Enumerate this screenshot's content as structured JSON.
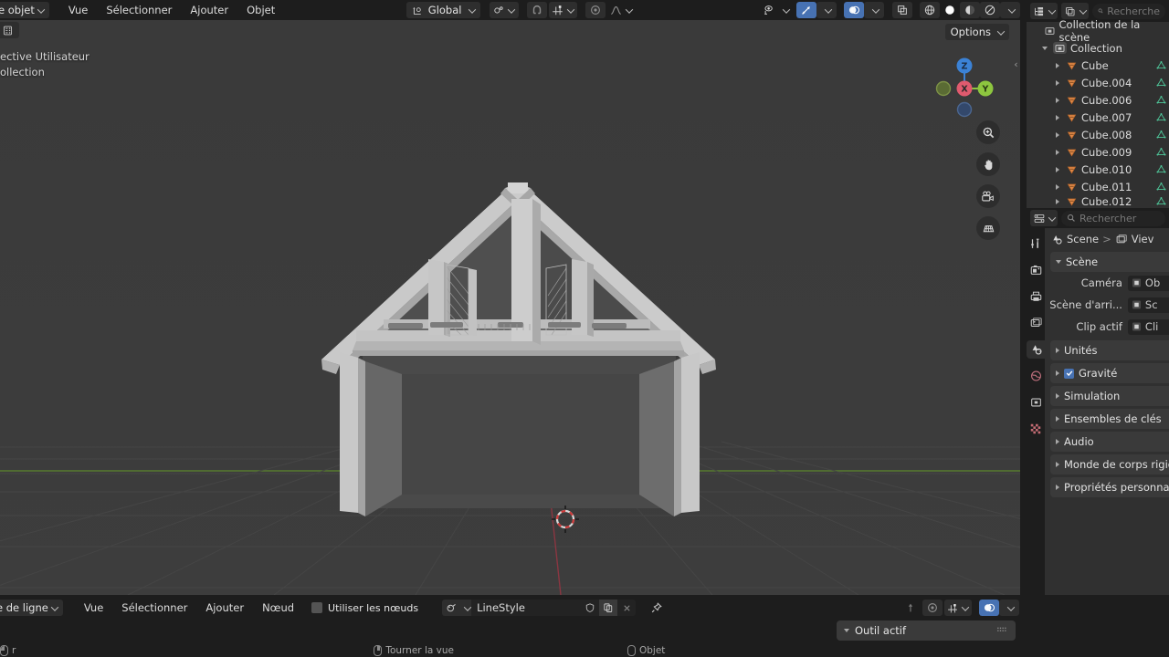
{
  "app": {
    "name": "Blender",
    "language": "fr"
  },
  "viewport_header": {
    "mode": "e objet",
    "menus": [
      "Vue",
      "Sélectionner",
      "Ajouter",
      "Objet"
    ],
    "transform_orientation": "Global",
    "icons": {
      "transform_orientation": "orientation-icon",
      "snap_magnet": "magnet-icon",
      "snap_type": "snap-increment-icon",
      "proportional": "proportional-editing-icon",
      "falloff": "falloff-curve-icon",
      "visibility": "object-visibility-icon",
      "gizmo": "gizmo-icon",
      "overlays": "overlays-icon",
      "xray": "xray-icon",
      "shading_wireframe": "shading-wireframe-icon",
      "shading_solid": "shading-solid-icon",
      "shading_material": "shading-material-icon",
      "shading_rendered": "shading-rendered-icon"
    }
  },
  "viewport": {
    "overlay_lines": [
      "ective Utilisateur",
      "ollection"
    ],
    "options_label": "Options",
    "gizmo_axes": [
      {
        "label": "Z",
        "color": "#3b82d6"
      },
      {
        "label": "X",
        "color": "#e05a6e"
      },
      {
        "label": "Y",
        "color": "#8dc63f"
      }
    ],
    "nav_buttons": [
      "zoom-icon",
      "hand-pan-icon",
      "camera-view-icon",
      "ortho-persp-icon"
    ],
    "colors": {
      "background": "#3b3b3b",
      "grid": "#4a4a4a",
      "axis_x_red": "#a33b45",
      "axis_y_green": "#6b9e32",
      "model_light": "#cfcfcf",
      "model_mid": "#a8a8a8",
      "model_dark": "#585858"
    },
    "cursor": "3d-cursor"
  },
  "outliner": {
    "search_placeholder": "Recherche",
    "display_mode_icon": "outliner-display-mode-icon",
    "filter_icon": "filter-icon",
    "scene_collection": "Collection de la scène",
    "collection": "Collection",
    "objects": [
      "Cube",
      "Cube.004",
      "Cube.006",
      "Cube.007",
      "Cube.008",
      "Cube.009",
      "Cube.010",
      "Cube.011",
      "Cube.012"
    ]
  },
  "properties": {
    "editor_icon": "properties-editor-icon",
    "search_placeholder": "Rechercher",
    "tabs": [
      "tool-icon",
      "render-icon",
      "output-icon",
      "view-layer-icon",
      "scene-icon",
      "world-icon",
      "collection-icon",
      "texture-icon"
    ],
    "active_tab": "scene-icon",
    "breadcrumb": [
      "Scene",
      "Viev"
    ],
    "panel_title": "Scène",
    "fields": [
      {
        "label": "Caméra",
        "value": "Ob",
        "icon": "camera-data-icon"
      },
      {
        "label": "Scène d'arri...",
        "value": "Sc",
        "icon": "scene-icon"
      },
      {
        "label": "Clip actif",
        "value": "Cli",
        "icon": "movie-clip-icon"
      }
    ],
    "sections": [
      {
        "label": "Unités",
        "checkbox": false
      },
      {
        "label": "Gravité",
        "checkbox": true
      },
      {
        "label": "Simulation",
        "checkbox": false
      },
      {
        "label": "Ensembles de clés",
        "checkbox": false
      },
      {
        "label": "Audio",
        "checkbox": false
      },
      {
        "label": "Monde de corps rigid",
        "checkbox": false
      },
      {
        "label": "Propriétés personnali",
        "checkbox": false
      }
    ]
  },
  "shader_editor": {
    "editor_type": "e de ligne",
    "menus": [
      "Vue",
      "Sélectionner",
      "Ajouter",
      "Nœud"
    ],
    "use_nodes_label": "Utiliser les nœuds",
    "use_nodes_checked": false,
    "datablock_name": "LineStyle",
    "datablock_icon": "linestyle-icon",
    "shield_icon": "fake-user-icon",
    "copy_icon": "new-copy-icon",
    "close_icon": "unlink-icon",
    "pin_icon": "pin-icon",
    "right_icons": [
      "snap-to-node-icon",
      "proportional-editing-icon",
      "snapping-icon",
      "overlays-icon"
    ]
  },
  "tool_panel": {
    "label": "Outil actif",
    "grip_icon": "grip-dots-icon"
  },
  "statusbar": {
    "items": [
      {
        "icon": "mouse-left-icon",
        "label": "r"
      },
      {
        "icon": "mouse-middle-icon",
        "label": "Tourner la vue"
      },
      {
        "icon": "mouse-right-icon",
        "label": "Objet"
      }
    ]
  }
}
